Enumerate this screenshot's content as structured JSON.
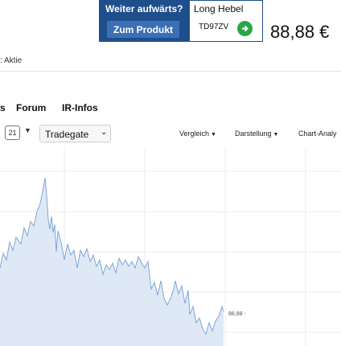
{
  "ad": {
    "question": "Weiter aufwärts?",
    "button": "Zum Produkt",
    "title": "Long Hebel",
    "code": "TD97ZV"
  },
  "price": "88,88 €",
  "subline": ": Aktie",
  "nav": [
    "s",
    "Forum",
    "IR-Infos"
  ],
  "toolbar": {
    "calendar_day": "21",
    "exchange": "Tradegate",
    "compare": "Vergleich",
    "display": "Darstellung",
    "analysis": "Chart-Analy"
  },
  "chart": {
    "last_label": "88,88 -",
    "colors": {
      "line": "#7fa6d6",
      "fill": "#dfe9f6",
      "grid": "#ececec"
    }
  }
}
